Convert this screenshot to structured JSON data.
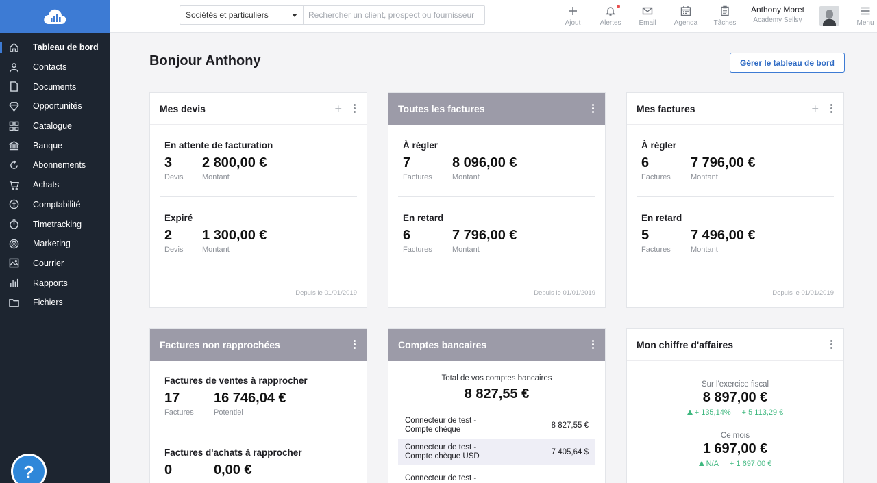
{
  "sidebar": {
    "items": [
      {
        "label": "Tableau de bord",
        "icon": "home-icon"
      },
      {
        "label": "Contacts",
        "icon": "user-icon"
      },
      {
        "label": "Documents",
        "icon": "document-icon"
      },
      {
        "label": "Opportunités",
        "icon": "diamond-icon"
      },
      {
        "label": "Catalogue",
        "icon": "grid-icon"
      },
      {
        "label": "Banque",
        "icon": "bank-icon"
      },
      {
        "label": "Abonnements",
        "icon": "refresh-icon"
      },
      {
        "label": "Achats",
        "icon": "cart-icon"
      },
      {
        "label": "Comptabilité",
        "icon": "accounting-icon"
      },
      {
        "label": "Timetracking",
        "icon": "stopwatch-icon"
      },
      {
        "label": "Marketing",
        "icon": "target-icon"
      },
      {
        "label": "Courrier",
        "icon": "image-icon"
      },
      {
        "label": "Rapports",
        "icon": "bar-chart-icon"
      },
      {
        "label": "Fichiers",
        "icon": "folder-icon"
      }
    ],
    "help_label": "?"
  },
  "topbar": {
    "filter_value": "Sociétés et particuliers",
    "search_placeholder": "Rechercher un client, prospect ou fournisseur",
    "actions": {
      "add": "Ajout",
      "alerts": "Alertes",
      "email": "Email",
      "agenda": "Agenda",
      "tasks": "Tâches",
      "menu": "Menu"
    },
    "user_name": "Anthony Moret",
    "user_org": "Academy Sellsy"
  },
  "main": {
    "greeting": "Bonjour Anthony",
    "manage_button": "Gérer le tableau de bord",
    "since_label": "Depuis le 01/01/2019"
  },
  "cards": {
    "devis": {
      "title": "Mes devis",
      "s1": {
        "title": "En attente de facturation",
        "count": "3",
        "count_cap": "Devis",
        "amount": "2 800,00 €",
        "amount_cap": "Montant"
      },
      "s2": {
        "title": "Expiré",
        "count": "2",
        "count_cap": "Devis",
        "amount": "1 300,00 €",
        "amount_cap": "Montant"
      }
    },
    "all_invoices": {
      "title": "Toutes les factures",
      "s1": {
        "title": "À régler",
        "count": "7",
        "count_cap": "Factures",
        "amount": "8 096,00 €",
        "amount_cap": "Montant"
      },
      "s2": {
        "title": "En retard",
        "count": "6",
        "count_cap": "Factures",
        "amount": "7 796,00 €",
        "amount_cap": "Montant"
      }
    },
    "my_invoices": {
      "title": "Mes factures",
      "s1": {
        "title": "À régler",
        "count": "6",
        "count_cap": "Factures",
        "amount": "7 796,00 €",
        "amount_cap": "Montant"
      },
      "s2": {
        "title": "En retard",
        "count": "5",
        "count_cap": "Factures",
        "amount": "7 496,00 €",
        "amount_cap": "Montant"
      }
    },
    "unreconciled": {
      "title": "Factures non rapprochées",
      "s1": {
        "title": "Factures de ventes à rapprocher",
        "count": "17",
        "count_cap": "Factures",
        "amount": "16 746,04 €",
        "amount_cap": "Potentiel"
      },
      "s2": {
        "title": "Factures d'achats à rapprocher",
        "count": "0",
        "amount": "0,00 €"
      }
    },
    "bank": {
      "title": "Comptes bancaires",
      "total_label": "Total de vos comptes bancaires",
      "total": "8 827,55 €",
      "accounts": [
        {
          "name1": "Connecteur de test -",
          "name2": "Compte chèque",
          "value": "8 827,55 €"
        },
        {
          "name1": "Connecteur de test -",
          "name2": "Compte chèque USD",
          "value": "7 405,64 $"
        },
        {
          "name1": "Connecteur de test -",
          "name2": "",
          "value": ""
        }
      ]
    },
    "revenue": {
      "title": "Mon chiffre d'affaires",
      "fiscal_label": "Sur l'exercice fiscal",
      "fiscal_value": "8 897,00 €",
      "fiscal_pct": "+ 135,14%",
      "fiscal_abs": "+ 5 113,29 €",
      "month_label": "Ce mois",
      "month_value": "1 697,00 €",
      "month_pct": "N/A",
      "month_abs": "+ 1 697,00 €"
    }
  },
  "colors": {
    "sidebar_bg": "#1d2530",
    "brand_blue": "#3d7bd4",
    "grey_header": "#9c9ba8",
    "positive_green": "#3fb87f",
    "alert_red": "#e8504f"
  }
}
